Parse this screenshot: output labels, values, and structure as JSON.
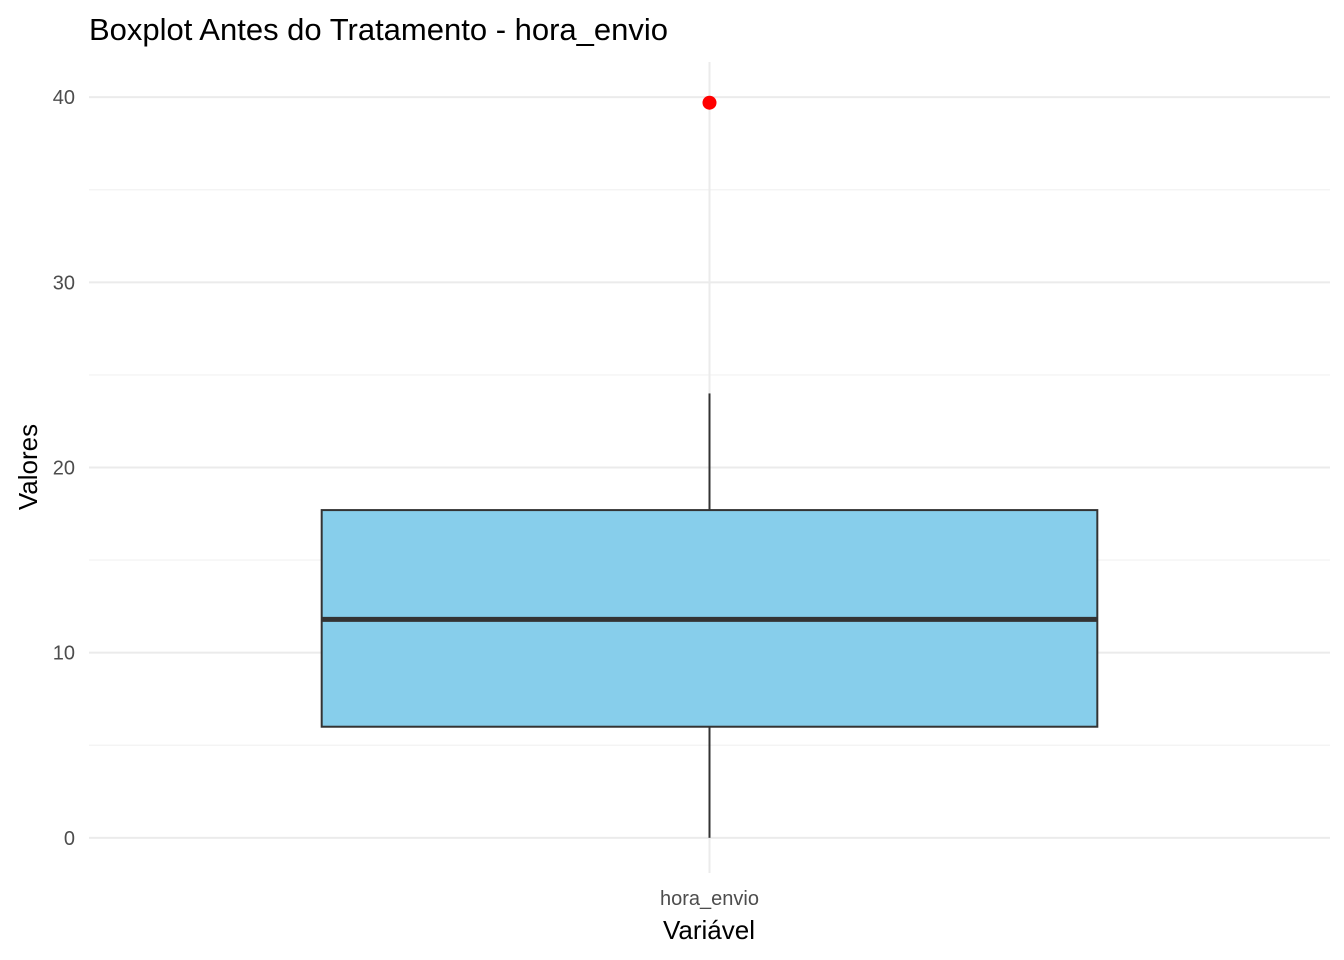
{
  "chart_data": {
    "type": "boxplot",
    "title": "Boxplot Antes do Tratamento - hora_envio",
    "xlabel": "Variável",
    "ylabel": "Valores",
    "categories": [
      "hora_envio"
    ],
    "ylim": [
      -1.9,
      41.9
    ],
    "y_ticks": [
      0,
      10,
      20,
      30,
      40
    ],
    "y_minor_ticks": [
      5,
      15,
      25,
      35
    ],
    "grid": true,
    "legend": "none",
    "boxes": [
      {
        "category": "hora_envio",
        "whisker_low": 0,
        "q1": 6,
        "median": 11.8,
        "q3": 17.7,
        "whisker_high": 24,
        "outliers": [
          39.7
        ]
      }
    ],
    "colors": {
      "box_fill": "#87CEEB",
      "box_line": "#333333",
      "outlier": "#ff0000",
      "background": "#ffffff"
    }
  }
}
